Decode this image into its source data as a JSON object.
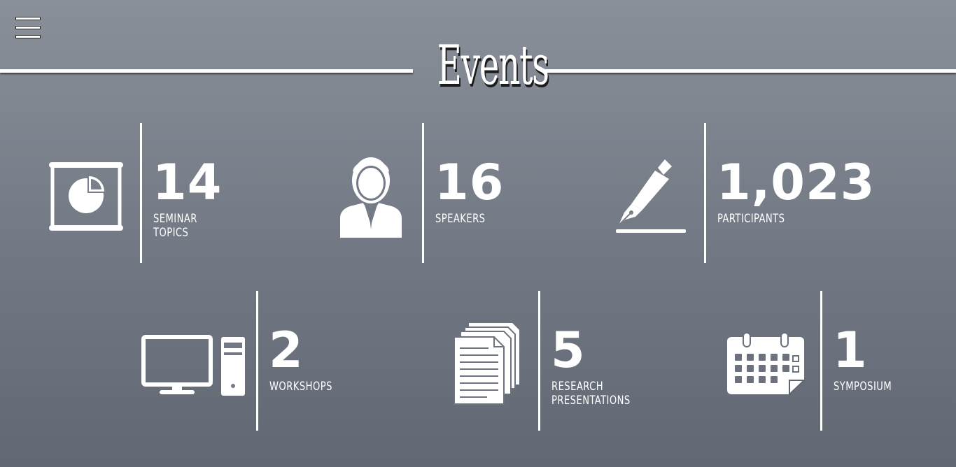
{
  "header": {
    "menu_icon": "hamburger-menu-icon",
    "title": "Events"
  },
  "stats": [
    {
      "value": "14",
      "label": "SEMINAR  TOPICS",
      "icon": "presentation-board-icon"
    },
    {
      "value": "16",
      "label": "SPEAKERS",
      "icon": "speaker-person-icon"
    },
    {
      "value": "1,023",
      "label": "PARTICIPANTS",
      "icon": "fountain-pen-icon"
    },
    {
      "value": "2",
      "label": "WORKSHOPS",
      "icon": "desktop-computer-icon"
    },
    {
      "value": "5",
      "label": "RESEARCH\nPRESENTATIONS",
      "icon": "document-stack-icon"
    },
    {
      "value": "1",
      "label": "SYMPOSIUM",
      "icon": "calendar-icon"
    }
  ],
  "colors": {
    "background_top": "#8a9099",
    "background_bottom": "#626873",
    "foreground": "#ffffff",
    "title_shadow": "#1b1b1b"
  }
}
